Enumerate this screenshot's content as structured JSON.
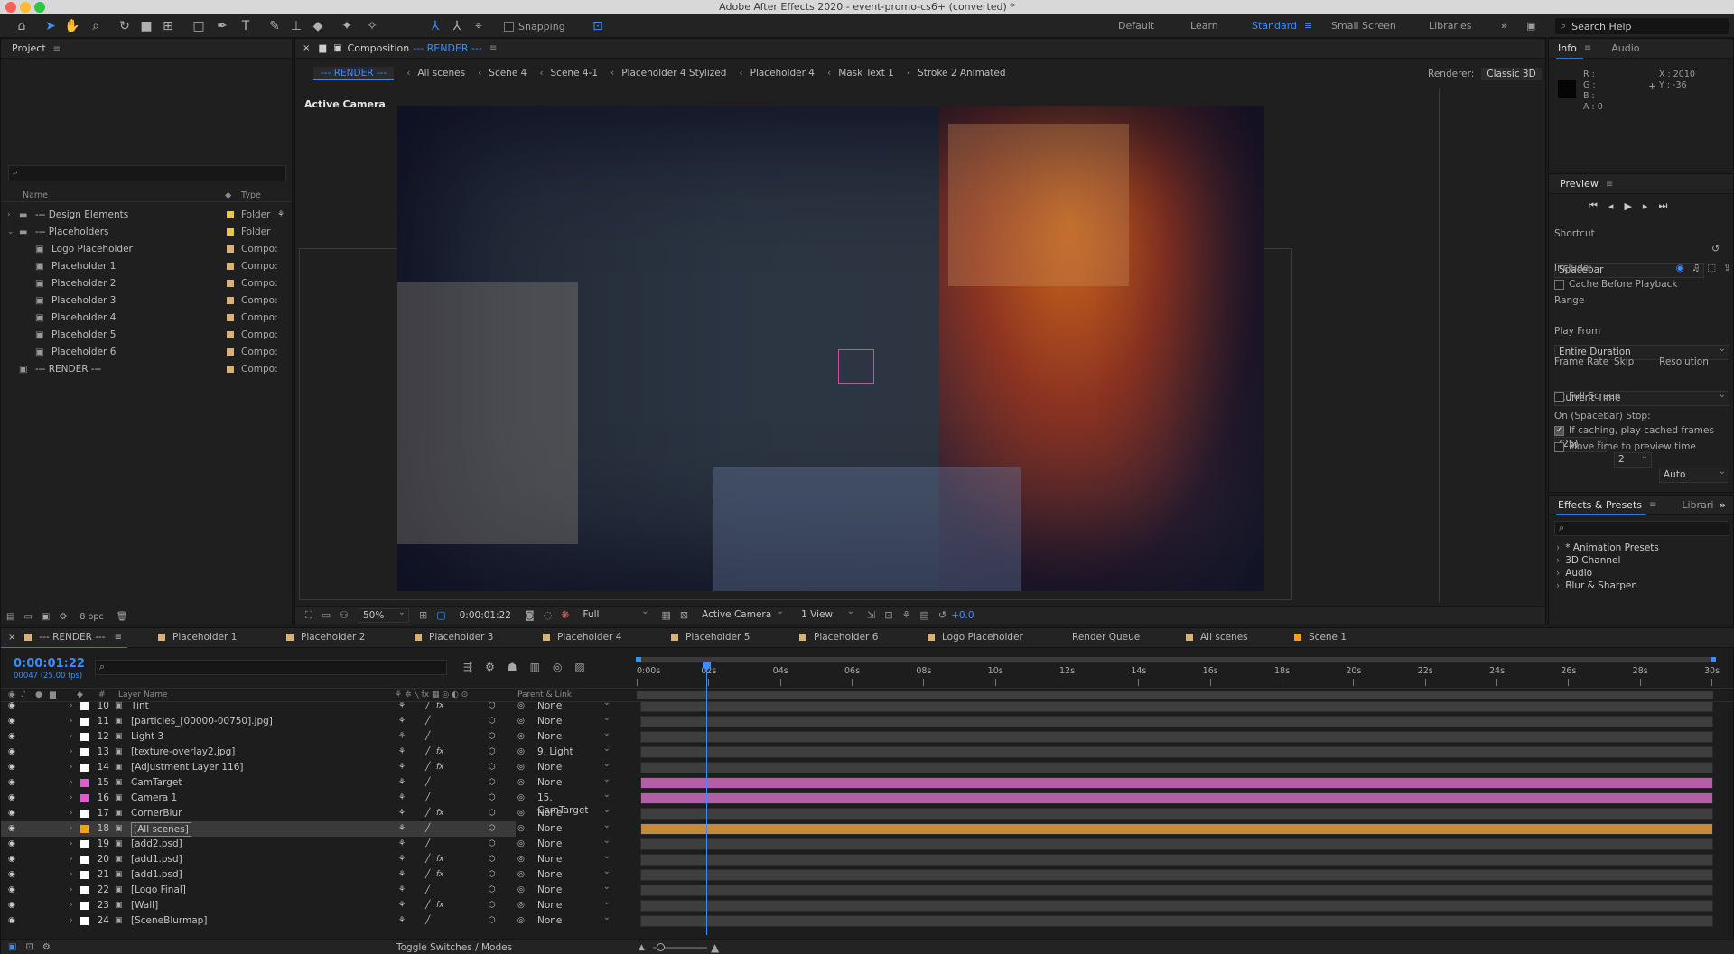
{
  "window": {
    "title": "Adobe After Effects 2020 - event-promo-cs6+ (converted) *"
  },
  "toolbar": {
    "snapping": "Snapping",
    "workspaces": [
      "Default",
      "Learn",
      "Standard",
      "Small Screen",
      "Libraries"
    ],
    "search_placeholder": "Search Help"
  },
  "project": {
    "title": "Project",
    "col_name": "Name",
    "col_type": "Type",
    "items": [
      {
        "name": "--- Design Elements",
        "type": "Folder",
        "color": "#e6c84a",
        "indent": 0,
        "expanded": false,
        "icon": "folder"
      },
      {
        "name": "--- Placeholders",
        "type": "Folder",
        "color": "#e6c84a",
        "indent": 0,
        "expanded": true,
        "icon": "folder"
      },
      {
        "name": "Logo Placeholder",
        "type": "Compo:",
        "color": "#d6b17a",
        "indent": 1,
        "icon": "comp"
      },
      {
        "name": "Placeholder 1",
        "type": "Compo:",
        "color": "#d6b17a",
        "indent": 1,
        "icon": "comp"
      },
      {
        "name": "Placeholder 2",
        "type": "Compo:",
        "color": "#d6b17a",
        "indent": 1,
        "icon": "comp"
      },
      {
        "name": "Placeholder 3",
        "type": "Compo:",
        "color": "#d6b17a",
        "indent": 1,
        "icon": "comp"
      },
      {
        "name": "Placeholder 4",
        "type": "Compo:",
        "color": "#d6b17a",
        "indent": 1,
        "icon": "comp"
      },
      {
        "name": "Placeholder 5",
        "type": "Compo:",
        "color": "#d6b17a",
        "indent": 1,
        "icon": "comp"
      },
      {
        "name": "Placeholder 6",
        "type": "Compo:",
        "color": "#d6b17a",
        "indent": 1,
        "icon": "comp"
      },
      {
        "name": "--- RENDER ---",
        "type": "Compo:",
        "color": "#d6b17a",
        "indent": 0,
        "icon": "comp"
      }
    ],
    "bpc": "8 bpc"
  },
  "comp": {
    "prefix": "Composition",
    "name": "--- RENDER ---",
    "breadcrumbs": [
      "--- RENDER ---",
      "All scenes",
      "Scene 4",
      "Scene 4-1",
      "Placeholder 4 Stylized",
      "Placeholder 4",
      "Mask Text 1",
      "Stroke 2 Animated"
    ],
    "renderer_label": "Renderer:",
    "renderer": "Classic 3D",
    "view_label": "Active Camera",
    "zoom": "50%",
    "time": "0:00:01:22",
    "resolution": "Full",
    "camera": "Active Camera",
    "views": "1 View",
    "exposure": "+0.0"
  },
  "info": {
    "tab": "Info",
    "tab2": "Audio",
    "r": "R :",
    "g": "G :",
    "b": "B :",
    "a": "A :  0",
    "x": "X : 2010",
    "y": "Y : -36"
  },
  "preview": {
    "title": "Preview",
    "shortcut_label": "Shortcut",
    "shortcut": "Spacebar",
    "include_label": "Include:",
    "cache": "Cache Before Playback",
    "range_label": "Range",
    "range": "Entire Duration",
    "playfrom_label": "Play From",
    "playfrom": "Current Time",
    "fr_label": "Frame Rate",
    "skip_label": "Skip",
    "res_label": "Resolution",
    "fr": "(25)",
    "skip": "2",
    "res": "Auto",
    "fullscreen": "Full Screen",
    "stop_label": "On (Spacebar) Stop:",
    "if_caching": "If caching, play cached frames",
    "move_time": "Move time to preview time"
  },
  "effects": {
    "tab": "Effects & Presets",
    "tab2": "Librari",
    "items": [
      "* Animation Presets",
      "3D Channel",
      "Audio",
      "Blur & Sharpen"
    ]
  },
  "timeline": {
    "tabs": [
      {
        "label": "--- RENDER ---",
        "color": "#d6b17a"
      },
      {
        "label": "Placeholder 1",
        "color": "#d6b17a"
      },
      {
        "label": "Placeholder 2",
        "color": "#d6b17a"
      },
      {
        "label": "Placeholder 3",
        "color": "#d6b17a"
      },
      {
        "label": "Placeholder 4",
        "color": "#d6b17a"
      },
      {
        "label": "Placeholder 5",
        "color": "#d6b17a"
      },
      {
        "label": "Placeholder 6",
        "color": "#d6b17a"
      },
      {
        "label": "Logo Placeholder",
        "color": "#d6b17a"
      },
      {
        "label": "Render Queue",
        "color": ""
      },
      {
        "label": "All scenes",
        "color": "#d6b17a"
      },
      {
        "label": "Scene 1",
        "color": "#f0a020"
      }
    ],
    "timecode": "0:00:01:22",
    "frame": "00047 (25.00 fps)",
    "layer_name_header": "Layer Name",
    "parent_header": "Parent & Link",
    "ruler": [
      "0:00s",
      "02s",
      "04s",
      "06s",
      "08s",
      "10s",
      "12s",
      "14s",
      "16s",
      "18s",
      "20s",
      "22s",
      "24s",
      "26s",
      "28s",
      "30s"
    ],
    "layers": [
      {
        "n": "10",
        "name": "Tint",
        "color": "#ffffff",
        "parent": "None",
        "fx": true
      },
      {
        "n": "11",
        "name": "[particles_[00000-00750].jpg]",
        "color": "#ffffff",
        "parent": "None",
        "fx": false
      },
      {
        "n": "12",
        "name": "Light 3",
        "color": "#ffffff",
        "parent": "None",
        "fx": false
      },
      {
        "n": "13",
        "name": "[texture-overlay2.jpg]",
        "color": "#ffffff",
        "parent": "9. Light",
        "fx": true
      },
      {
        "n": "14",
        "name": "[Adjustment Layer 116]",
        "color": "#ffffff",
        "parent": "None",
        "fx": true
      },
      {
        "n": "15",
        "name": "CamTarget",
        "color": "#e05bd0",
        "parent": "None",
        "fx": false
      },
      {
        "n": "16",
        "name": "Camera 1",
        "color": "#e05bd0",
        "parent": "15. CamTarget",
        "fx": false
      },
      {
        "n": "17",
        "name": "CornerBlur",
        "color": "#ffffff",
        "parent": "None",
        "fx": true
      },
      {
        "n": "18",
        "name": "[All scenes]",
        "color": "#f0a020",
        "parent": "None",
        "fx": false
      },
      {
        "n": "19",
        "name": "[add2.psd]",
        "color": "#ffffff",
        "parent": "None",
        "fx": false
      },
      {
        "n": "20",
        "name": "[add1.psd]",
        "color": "#ffffff",
        "parent": "None",
        "fx": true
      },
      {
        "n": "21",
        "name": "[add1.psd]",
        "color": "#ffffff",
        "parent": "None",
        "fx": true
      },
      {
        "n": "22",
        "name": "[Logo Final]",
        "color": "#ffffff",
        "parent": "None",
        "fx": false
      },
      {
        "n": "23",
        "name": "[Wall]",
        "color": "#ffffff",
        "parent": "None",
        "fx": true
      },
      {
        "n": "24",
        "name": "[SceneBlurmap]",
        "color": "#ffffff",
        "parent": "None",
        "fx": false
      }
    ],
    "footer": "Toggle Switches / Modes"
  }
}
